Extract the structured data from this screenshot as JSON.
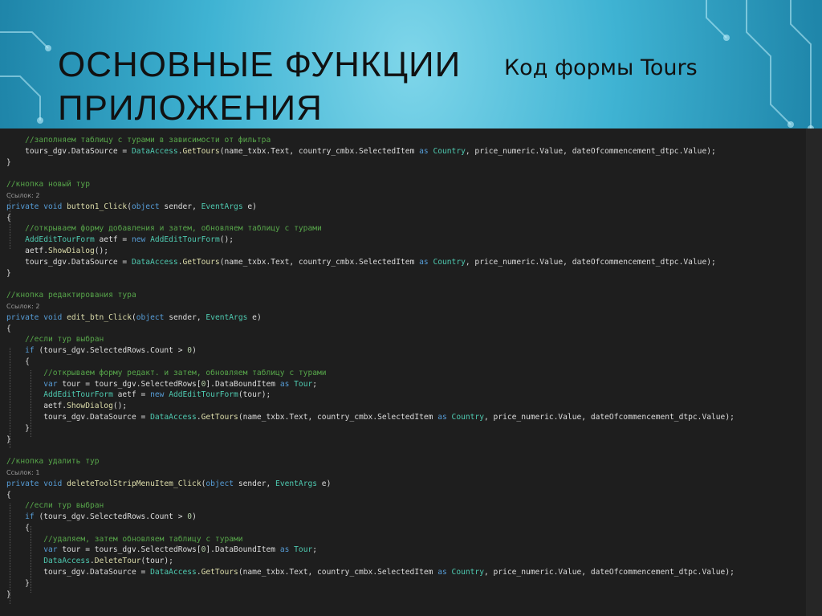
{
  "slide": {
    "title": "ОСНОВНЫЕ ФУНКЦИИ\nПРИЛОЖЕНИЯ",
    "subtitle": "Код формы Tours"
  },
  "colors": {
    "comment": "#57a64a",
    "keyword": "#569cd6",
    "type": "#4ec9b0",
    "method": "#dcdcaa",
    "plain": "#dcdcdc",
    "number": "#b5cea8",
    "param": "#9cdcfe",
    "refs": "#9c9c9c",
    "code_bg": "#1e1e1e"
  },
  "code": {
    "lines": [
      {
        "tokens": [
          [
            "    ",
            "pl"
          ],
          [
            "//заполняем таблицу с турами в зависимости от фильтра",
            "cm"
          ]
        ]
      },
      {
        "tokens": [
          [
            "    tours_dgv.DataSource = ",
            "pl"
          ],
          [
            "DataAccess",
            "ty"
          ],
          [
            ".",
            "pl"
          ],
          [
            "GetTours",
            "fn"
          ],
          [
            "(name_txbx.Text, country_cmbx.SelectedItem ",
            "pl"
          ],
          [
            "as",
            "kw"
          ],
          [
            " ",
            "pl"
          ],
          [
            "Country",
            "ty"
          ],
          [
            ", price_numeric.Value, dateOfcommencement_dtpc.Value);",
            "pl"
          ]
        ]
      },
      {
        "tokens": [
          [
            "}",
            "pl"
          ]
        ]
      },
      {
        "blank": true
      },
      {
        "tokens": [
          [
            "//кнопка новый тур",
            "cm"
          ]
        ]
      },
      {
        "refs": "Ссылок: 2"
      },
      {
        "tokens": [
          [
            "private",
            "kw"
          ],
          [
            " ",
            "pl"
          ],
          [
            "void",
            "kw"
          ],
          [
            " ",
            "pl"
          ],
          [
            "button1_Click",
            "fn"
          ],
          [
            "(",
            "pl"
          ],
          [
            "object",
            "kw"
          ],
          [
            " sender, ",
            "pl"
          ],
          [
            "EventArgs",
            "ty"
          ],
          [
            " e)",
            "pl"
          ]
        ]
      },
      {
        "tokens": [
          [
            "{",
            "pl"
          ]
        ]
      },
      {
        "tokens": [
          [
            "    ",
            "pl"
          ],
          [
            "//открываем форму добавления и затем, обновляем таблицу с турами",
            "cm"
          ]
        ]
      },
      {
        "tokens": [
          [
            "    ",
            "pl"
          ],
          [
            "AddEditTourForm",
            "ty"
          ],
          [
            " aetf = ",
            "pl"
          ],
          [
            "new",
            "kw"
          ],
          [
            " ",
            "pl"
          ],
          [
            "AddEditTourForm",
            "ty"
          ],
          [
            "();",
            "pl"
          ]
        ]
      },
      {
        "tokens": [
          [
            "    aetf.",
            "pl"
          ],
          [
            "ShowDialog",
            "fn"
          ],
          [
            "();",
            "pl"
          ]
        ]
      },
      {
        "tokens": [
          [
            "    tours_dgv.DataSource = ",
            "pl"
          ],
          [
            "DataAccess",
            "ty"
          ],
          [
            ".",
            "pl"
          ],
          [
            "GetTours",
            "fn"
          ],
          [
            "(name_txbx.Text, country_cmbx.SelectedItem ",
            "pl"
          ],
          [
            "as",
            "kw"
          ],
          [
            " ",
            "pl"
          ],
          [
            "Country",
            "ty"
          ],
          [
            ", price_numeric.Value, dateOfcommencement_dtpc.Value);",
            "pl"
          ]
        ]
      },
      {
        "tokens": [
          [
            "}",
            "pl"
          ]
        ]
      },
      {
        "blank": true
      },
      {
        "tokens": [
          [
            "//кнопка редактирования тура",
            "cm"
          ]
        ]
      },
      {
        "refs": "Ссылок: 2"
      },
      {
        "tokens": [
          [
            "private",
            "kw"
          ],
          [
            " ",
            "pl"
          ],
          [
            "void",
            "kw"
          ],
          [
            " ",
            "pl"
          ],
          [
            "edit_btn_Click",
            "fn"
          ],
          [
            "(",
            "pl"
          ],
          [
            "object",
            "kw"
          ],
          [
            " sender, ",
            "pl"
          ],
          [
            "EventArgs",
            "ty"
          ],
          [
            " e)",
            "pl"
          ]
        ]
      },
      {
        "tokens": [
          [
            "{",
            "pl"
          ]
        ]
      },
      {
        "tokens": [
          [
            "    ",
            "pl"
          ],
          [
            "//если тур выбран",
            "cm"
          ]
        ]
      },
      {
        "tokens": [
          [
            "    ",
            "pl"
          ],
          [
            "if",
            "kw"
          ],
          [
            " (tours_dgv.SelectedRows.Count > ",
            "pl"
          ],
          [
            "0",
            "nu"
          ],
          [
            ")",
            "pl"
          ]
        ]
      },
      {
        "tokens": [
          [
            "    {",
            "pl"
          ]
        ]
      },
      {
        "tokens": [
          [
            "        ",
            "pl"
          ],
          [
            "//открываем форму редакт. и затем, обновляем таблицу с турами",
            "cm"
          ]
        ]
      },
      {
        "tokens": [
          [
            "        ",
            "pl"
          ],
          [
            "var",
            "kw"
          ],
          [
            " tour = tours_dgv.SelectedRows[",
            "pl"
          ],
          [
            "0",
            "nu"
          ],
          [
            "].DataBoundItem ",
            "pl"
          ],
          [
            "as",
            "kw"
          ],
          [
            " ",
            "pl"
          ],
          [
            "Tour",
            "ty"
          ],
          [
            ";",
            "pl"
          ]
        ]
      },
      {
        "tokens": [
          [
            "        ",
            "pl"
          ],
          [
            "AddEditTourForm",
            "ty"
          ],
          [
            " aetf = ",
            "pl"
          ],
          [
            "new",
            "kw"
          ],
          [
            " ",
            "pl"
          ],
          [
            "AddEditTourForm",
            "ty"
          ],
          [
            "(tour);",
            "pl"
          ]
        ]
      },
      {
        "tokens": [
          [
            "        aetf.",
            "pl"
          ],
          [
            "ShowDialog",
            "fn"
          ],
          [
            "();",
            "pl"
          ]
        ]
      },
      {
        "tokens": [
          [
            "        tours_dgv.DataSource = ",
            "pl"
          ],
          [
            "DataAccess",
            "ty"
          ],
          [
            ".",
            "pl"
          ],
          [
            "GetTours",
            "fn"
          ],
          [
            "(name_txbx.Text, country_cmbx.SelectedItem ",
            "pl"
          ],
          [
            "as",
            "kw"
          ],
          [
            " ",
            "pl"
          ],
          [
            "Country",
            "ty"
          ],
          [
            ", price_numeric.Value, dateOfcommencement_dtpc.Value);",
            "pl"
          ]
        ]
      },
      {
        "tokens": [
          [
            "    }",
            "pl"
          ]
        ]
      },
      {
        "tokens": [
          [
            "}",
            "pl"
          ]
        ]
      },
      {
        "blank": true
      },
      {
        "tokens": [
          [
            "//кнопка удалить тур",
            "cm"
          ]
        ]
      },
      {
        "refs": "Ссылок: 1"
      },
      {
        "tokens": [
          [
            "private",
            "kw"
          ],
          [
            " ",
            "pl"
          ],
          [
            "void",
            "kw"
          ],
          [
            " ",
            "pl"
          ],
          [
            "deleteToolStripMenuItem_Click",
            "fn"
          ],
          [
            "(",
            "pl"
          ],
          [
            "object",
            "kw"
          ],
          [
            " sender, ",
            "pl"
          ],
          [
            "EventArgs",
            "ty"
          ],
          [
            " e)",
            "pl"
          ]
        ]
      },
      {
        "tokens": [
          [
            "{",
            "pl"
          ]
        ]
      },
      {
        "tokens": [
          [
            "    ",
            "pl"
          ],
          [
            "//если тур выбран",
            "cm"
          ]
        ]
      },
      {
        "tokens": [
          [
            "    ",
            "pl"
          ],
          [
            "if",
            "kw"
          ],
          [
            " (tours_dgv.SelectedRows.Count > ",
            "pl"
          ],
          [
            "0",
            "nu"
          ],
          [
            ")",
            "pl"
          ]
        ]
      },
      {
        "tokens": [
          [
            "    {",
            "pl"
          ]
        ]
      },
      {
        "tokens": [
          [
            "        ",
            "pl"
          ],
          [
            "//удаляем, затем обновляем таблицу с турами",
            "cm"
          ]
        ]
      },
      {
        "tokens": [
          [
            "        ",
            "pl"
          ],
          [
            "var",
            "kw"
          ],
          [
            " tour = tours_dgv.SelectedRows[",
            "pl"
          ],
          [
            "0",
            "nu"
          ],
          [
            "].DataBoundItem ",
            "pl"
          ],
          [
            "as",
            "kw"
          ],
          [
            " ",
            "pl"
          ],
          [
            "Tour",
            "ty"
          ],
          [
            ";",
            "pl"
          ]
        ]
      },
      {
        "tokens": [
          [
            "        ",
            "pl"
          ],
          [
            "DataAccess",
            "ty"
          ],
          [
            ".",
            "pl"
          ],
          [
            "DeleteTour",
            "fn"
          ],
          [
            "(tour);",
            "pl"
          ]
        ]
      },
      {
        "tokens": [
          [
            "        tours_dgv.DataSource = ",
            "pl"
          ],
          [
            "DataAccess",
            "ty"
          ],
          [
            ".",
            "pl"
          ],
          [
            "GetTours",
            "fn"
          ],
          [
            "(name_txbx.Text, country_cmbx.SelectedItem ",
            "pl"
          ],
          [
            "as",
            "kw"
          ],
          [
            " ",
            "pl"
          ],
          [
            "Country",
            "ty"
          ],
          [
            ", price_numeric.Value, dateOfcommencement_dtpc.Value);",
            "pl"
          ]
        ]
      },
      {
        "tokens": [
          [
            "    }",
            "pl"
          ]
        ]
      },
      {
        "tokens": [
          [
            "}",
            "pl"
          ]
        ]
      }
    ]
  }
}
